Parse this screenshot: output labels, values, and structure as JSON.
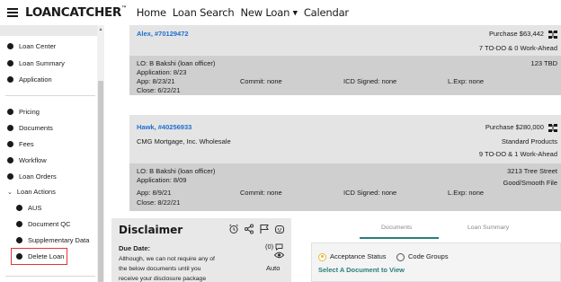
{
  "header": {
    "logo_part1": "LOAN",
    "logo_part2": "CATCHER",
    "logo_tm": "™",
    "nav": [
      "Home",
      "Loan Search",
      "New Loan",
      "Calendar"
    ],
    "new_loan_caret": "▼"
  },
  "sidebar": {
    "items": [
      "Loan Center",
      "Loan Summary",
      "Application",
      "Pricing",
      "Documents",
      "Fees",
      "Workflow",
      "Loan Orders"
    ],
    "group_label": "Loan Actions",
    "group_chevron": "⌄",
    "sub_items": [
      "AUS",
      "Document QC",
      "Supplementary Data",
      "Delete Loan"
    ],
    "highlighted": "Delete Loan",
    "highlight_color": "#e0343a"
  },
  "loans": [
    {
      "name": "Alex, #70129472",
      "purpose_label": "Purchase",
      "amount": "$63,442",
      "todo": "7 TO-DO & 0 Work-Ahead",
      "officer": "LO:  B Bakshi (loan officer)",
      "application": "Application:  8/23",
      "app": "App:  8/23/21",
      "commit": "Commit:  none",
      "icd": "ICD Signed:  none",
      "lexp": "L.Exp:  none",
      "close": "Close:  6/22/21",
      "address": "123 TBD"
    },
    {
      "name": "Hawk, #40256933",
      "purpose_label": "Purchase",
      "amount": "$280,000",
      "lender": "CMG Mortgage, Inc. Wholesale",
      "product": "Standard Products",
      "todo": "9 TO-DO & 1 Work-Ahead",
      "officer": "LO:  B Bakshi (loan officer)",
      "application": "Application:  8/09",
      "app": "App:  8/9/21",
      "commit": "Commit:  none",
      "icd": "ICD Signed:  none",
      "lexp": "L.Exp:  none",
      "close": "Close:  8/22/21",
      "address": "3213 Tree Street",
      "file_status": "Good/Smooth File"
    }
  ],
  "disclaimer": {
    "title": "Disclaimer",
    "due_label": "Due Date:",
    "count": "(0)",
    "text_lines": [
      "Although, we can not require any of",
      "the below documents until you",
      "receive your disclosure package"
    ],
    "auto": "Auto"
  },
  "doc_tabs": {
    "tabs": [
      "Documents",
      "Loan Summary"
    ],
    "active": "Documents",
    "accent": "#2a7d7b"
  },
  "acceptance": {
    "option1": "Acceptance Status",
    "option2": "Code Groups",
    "selected": "Acceptance Status",
    "prompt": "Select A Document to View"
  },
  "colors": {
    "link_blue": "#1d6fd1",
    "card_light": "#e4e4e4",
    "card_dark": "#cfcfcf"
  }
}
